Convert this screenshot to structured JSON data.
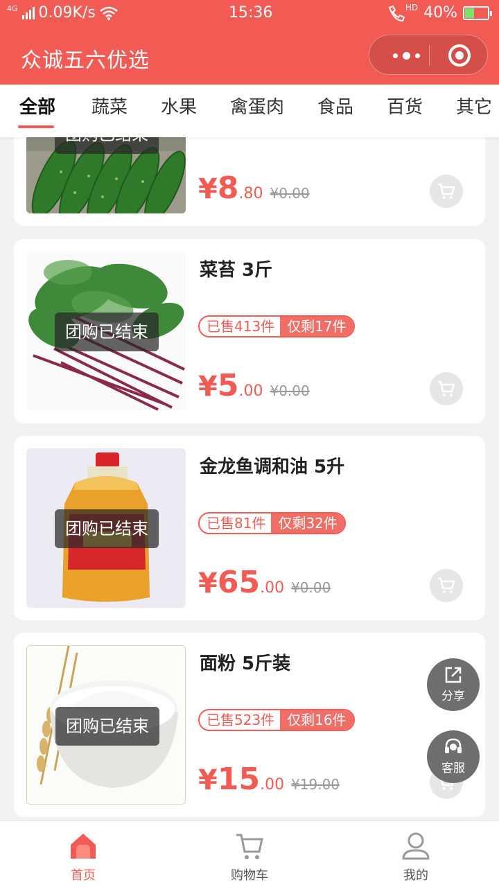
{
  "status_bar": {
    "network_type": "4G",
    "speed": "0.09K/s",
    "time": "15:36",
    "hd_label": "HD",
    "battery": "40%",
    "battery_level": 0.4
  },
  "header": {
    "title": "众诚五六优选"
  },
  "tabs": [
    {
      "label": "全部",
      "active": true
    },
    {
      "label": "蔬菜"
    },
    {
      "label": "水果"
    },
    {
      "label": "禽蛋肉"
    },
    {
      "label": "食品"
    },
    {
      "label": "百货"
    },
    {
      "label": "其它"
    }
  ],
  "products": [
    {
      "name": "",
      "status_label": "团购已结束",
      "currency": "¥",
      "price_int": "8",
      "price_dec": ".80",
      "original_price": "¥0.00",
      "image": "cucumber"
    },
    {
      "name": "菜苔 3斤",
      "status_label": "团购已结束",
      "sold": "已售413件",
      "remaining": "仅剩17件",
      "currency": "¥",
      "price_int": "5",
      "price_dec": ".00",
      "original_price": "¥0.00",
      "image": "red-stem-greens"
    },
    {
      "name": "金龙鱼调和油 5升",
      "status_label": "团购已结束",
      "sold": "已售81件",
      "remaining": "仅剩32件",
      "currency": "¥",
      "price_int": "65",
      "price_dec": ".00",
      "original_price": "¥0.00",
      "image": "oil-bottle"
    },
    {
      "name": "面粉 5斤装",
      "status_label": "团购已结束",
      "sold": "已售523件",
      "remaining": "仅剩16件",
      "currency": "¥",
      "price_int": "15",
      "price_dec": ".00",
      "original_price": "¥19.00",
      "image": "flour-bowl"
    }
  ],
  "floating": {
    "share_label": "分享",
    "service_label": "客服"
  },
  "bottom_nav": [
    {
      "label": "首页",
      "icon": "home-icon",
      "active": true
    },
    {
      "label": "购物车",
      "icon": "cart-icon"
    },
    {
      "label": "我的",
      "icon": "user-icon"
    }
  ],
  "colors": {
    "brand": "#f25b54",
    "inactive_icon": "#999999"
  }
}
